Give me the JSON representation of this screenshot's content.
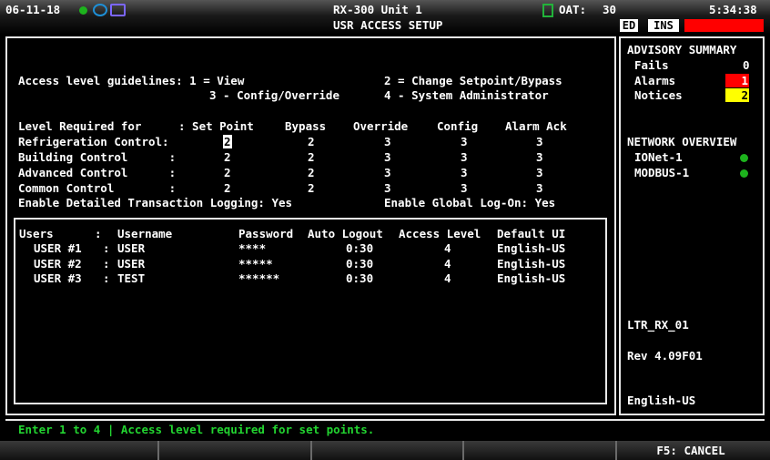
{
  "header": {
    "date": "06-11-18",
    "unit": "RX-300 Unit 1",
    "screen": "USR ACCESS SETUP",
    "oat_label": "OAT:",
    "oat_value": "30",
    "time": "5:34:38",
    "ed": "ED",
    "ins": "INS",
    "alarm_color": "#ff0000"
  },
  "guidelines": {
    "line1_left": "Access level guidelines: 1 = View",
    "line1_right": "2 = Change Setpoint/Bypass",
    "line2_left": "3 - Config/Override",
    "line2_right": "4 - System Administrator"
  },
  "levels": {
    "header": [
      "Level Required for",
      ": Set Point",
      "Bypass",
      "Override",
      "Config",
      "Alarm Ack"
    ],
    "rows": [
      {
        "name": "Refrigeration Control:",
        "set_point": "2",
        "bypass": "2",
        "override": "3",
        "config": "3",
        "alarm_ack": "3"
      },
      {
        "name": "Building Control      :",
        "set_point": "2",
        "bypass": "2",
        "override": "3",
        "config": "3",
        "alarm_ack": "3"
      },
      {
        "name": "Advanced Control      :",
        "set_point": "2",
        "bypass": "2",
        "override": "3",
        "config": "3",
        "alarm_ack": "3"
      },
      {
        "name": "Common Control        :",
        "set_point": "2",
        "bypass": "2",
        "override": "3",
        "config": "3",
        "alarm_ack": "3"
      }
    ],
    "logging": "Enable Detailed Transaction Logging: Yes",
    "global_logon": "Enable Global Log-On: Yes"
  },
  "users": {
    "columns": [
      "Users",
      ":",
      "Username",
      "Password",
      "Auto Logout",
      "Access Level",
      "Default UI"
    ],
    "rows": [
      {
        "user": "USER #1",
        "colon": ":",
        "username": "USER",
        "password": "****",
        "logout": "0:30",
        "level": "4",
        "ui": "English-US"
      },
      {
        "user": "USER #2",
        "colon": ":",
        "username": "USER",
        "password": "*****",
        "logout": "0:30",
        "level": "4",
        "ui": "English-US"
      },
      {
        "user": "USER #3",
        "colon": ":",
        "username": "TEST",
        "password": "******",
        "logout": "0:30",
        "level": "4",
        "ui": "English-US"
      }
    ]
  },
  "sidebar": {
    "advisory_title": "ADVISORY SUMMARY",
    "fails_label": "Fails",
    "fails_value": "0",
    "alarms_label": "Alarms",
    "alarms_value": "1",
    "alarms_color": "#ff0000",
    "notices_label": "Notices",
    "notices_value": "2",
    "notices_color": "#ffff00",
    "network_title": "NETWORK OVERVIEW",
    "networks": [
      {
        "name": "IONet-1",
        "status_color": "#1db31d"
      },
      {
        "name": "MODBUS-1",
        "status_color": "#1db31d"
      }
    ],
    "device": "LTR_RX_01",
    "revision": "Rev 4.09F01",
    "language": "English-US"
  },
  "status_message": "Enter 1 to 4 | Access level required for set points.",
  "function_keys": [
    "",
    "",
    "",
    "",
    "F5: CANCEL"
  ]
}
